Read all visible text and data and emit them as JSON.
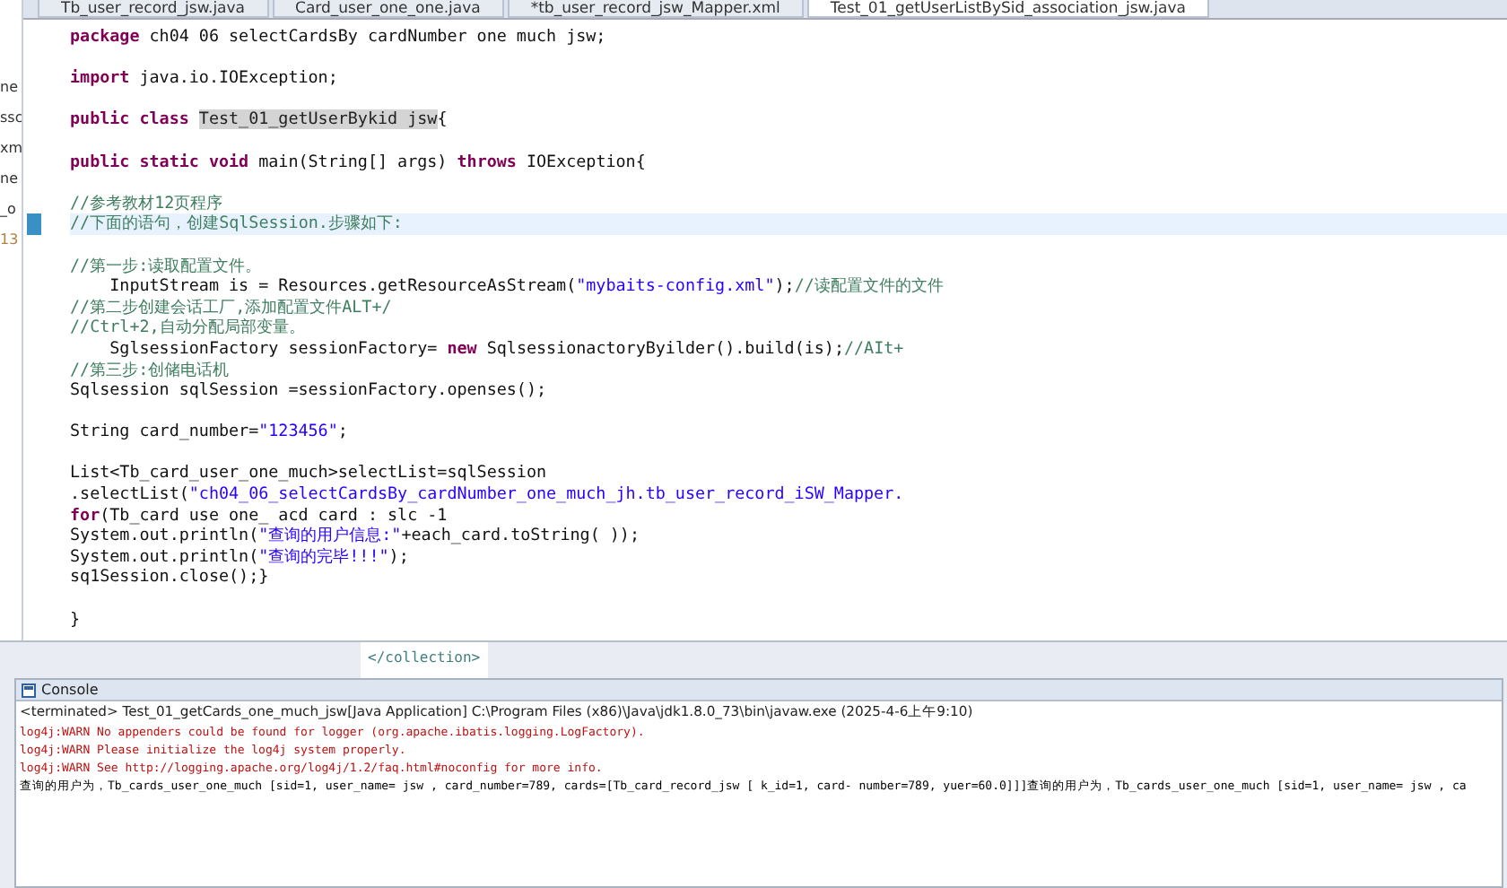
{
  "side_strip": [
    "ne",
    "ssc",
    "xm",
    "ne",
    "_o",
    "13"
  ],
  "editor_tabs": [
    {
      "label": "Tb_user_record_jsw.java",
      "selected": false
    },
    {
      "label": "Card_user_one_one.java",
      "selected": false
    },
    {
      "label": "*tb_user_record_jsw_Mapper.xml",
      "selected": false
    },
    {
      "label": "Test_01_getUserListBySid_association_jsw.java",
      "selected": true
    }
  ],
  "code_lines": [
    {
      "kind": "code",
      "current": false,
      "segments": [
        {
          "kind": "keyword",
          "text": "package"
        },
        {
          "kind": "plain",
          "text": " ch04 06 selectCardsBy cardNumber one much jsw;"
        }
      ]
    },
    {
      "kind": "blank",
      "current": false
    },
    {
      "kind": "code",
      "current": false,
      "segments": [
        {
          "kind": "keyword",
          "text": "import"
        },
        {
          "kind": "plain",
          "text": " java.io.IOException;"
        }
      ]
    },
    {
      "kind": "blank",
      "current": false
    },
    {
      "kind": "code",
      "current": false,
      "segments": [
        {
          "kind": "keyword",
          "text": "public class "
        },
        {
          "kind": "highlight",
          "text": "Test_01_getUserBykid jsw"
        },
        {
          "kind": "plain",
          "text": "{"
        }
      ]
    },
    {
      "kind": "blank",
      "current": false
    },
    {
      "kind": "code",
      "current": false,
      "segments": [
        {
          "kind": "keyword",
          "text": "public static void"
        },
        {
          "kind": "plain",
          "text": " main(String[] args) "
        },
        {
          "kind": "keyword",
          "text": "throws"
        },
        {
          "kind": "plain",
          "text": " IOException{"
        }
      ]
    },
    {
      "kind": "blank",
      "current": false
    },
    {
      "kind": "code",
      "current": false,
      "segments": [
        {
          "kind": "comment",
          "text": "//参考教材12页程序"
        }
      ]
    },
    {
      "kind": "code",
      "current": true,
      "segments": [
        {
          "kind": "comment",
          "text": "//下面的语句，创建SqlSession.步骤如下:"
        }
      ]
    },
    {
      "kind": "blank",
      "current": false
    },
    {
      "kind": "code",
      "current": false,
      "segments": [
        {
          "kind": "comment",
          "text": "//第一步:读取配置文件。"
        }
      ]
    },
    {
      "kind": "code",
      "current": false,
      "segments": [
        {
          "kind": "plain",
          "text": "    InputStream is = Resources.getResourceAsStream("
        },
        {
          "kind": "string",
          "text": "\"mybaits-config.xml\""
        },
        {
          "kind": "plain",
          "text": ");"
        },
        {
          "kind": "comment",
          "text": "//读配置文件的文件"
        }
      ]
    },
    {
      "kind": "code",
      "current": false,
      "segments": [
        {
          "kind": "comment",
          "text": "//第二步创建会话工厂,添加配置文件ALT+/"
        }
      ]
    },
    {
      "kind": "code",
      "current": false,
      "segments": [
        {
          "kind": "comment",
          "text": "//Ctrl+2,自动分配局部变量。"
        }
      ]
    },
    {
      "kind": "code",
      "current": false,
      "segments": [
        {
          "kind": "plain",
          "text": "    SglsessionFactory sessionFactory= "
        },
        {
          "kind": "keyword",
          "text": "new"
        },
        {
          "kind": "plain",
          "text": " SqlsessionactoryByilder().build(is);"
        },
        {
          "kind": "comment",
          "text": "//AIt+"
        }
      ]
    },
    {
      "kind": "code",
      "current": false,
      "segments": [
        {
          "kind": "comment",
          "text": "//第三步:创储电话机"
        }
      ]
    },
    {
      "kind": "code",
      "current": false,
      "segments": [
        {
          "kind": "plain",
          "text": "Sqlsession sqlSession =sessionFactory.openses();"
        }
      ]
    },
    {
      "kind": "blank",
      "current": false
    },
    {
      "kind": "code",
      "current": false,
      "segments": [
        {
          "kind": "plain",
          "text": "String card_number="
        },
        {
          "kind": "string",
          "text": "\"123456\""
        },
        {
          "kind": "plain",
          "text": ";"
        }
      ]
    },
    {
      "kind": "blank",
      "current": false
    },
    {
      "kind": "code",
      "current": false,
      "segments": [
        {
          "kind": "plain",
          "text": "List<Tb_card_user_one_much>selectList=sqlSession"
        }
      ]
    },
    {
      "kind": "code",
      "current": false,
      "segments": [
        {
          "kind": "plain",
          "text": ".selectList("
        },
        {
          "kind": "string",
          "text": "\"ch04_06_selectCardsBy_cardNumber_one_much_jh.tb_user_record_iSW_Mapper."
        }
      ]
    },
    {
      "kind": "code",
      "current": false,
      "segments": [
        {
          "kind": "keyword",
          "text": "for"
        },
        {
          "kind": "plain",
          "text": "(Tb_card use one_ acd card : slc -1"
        }
      ]
    },
    {
      "kind": "code",
      "current": false,
      "segments": [
        {
          "kind": "plain",
          "text": "System.out.println("
        },
        {
          "kind": "string",
          "text": "\"查询的用户信息:\""
        },
        {
          "kind": "plain",
          "text": "+each_card.toString( ));"
        }
      ]
    },
    {
      "kind": "code",
      "current": false,
      "segments": [
        {
          "kind": "plain",
          "text": "System.out.println("
        },
        {
          "kind": "string",
          "text": "\"查询的完毕!!!\""
        },
        {
          "kind": "plain",
          "text": ");"
        }
      ]
    },
    {
      "kind": "code",
      "current": false,
      "segments": [
        {
          "kind": "plain",
          "text": "sq1Session.close();}"
        }
      ]
    },
    {
      "kind": "blank",
      "current": false
    },
    {
      "kind": "code",
      "current": false,
      "segments": [
        {
          "kind": "plain",
          "text": "}"
        }
      ]
    }
  ],
  "xml_preview": "</collection>",
  "console": {
    "title": "Console",
    "header": "<terminated> Test_01_getCards_one_much_jsw[Java Application] C:\\Program Files (x86)\\Java\\jdk1.8.0_73\\bin\\javaw.exe (2025-4-6上午9:10)",
    "lines": [
      {
        "kind": "error",
        "text": "log4j:WARN No appenders could be found for logger (org.apache.ibatis.logging.LogFactory)."
      },
      {
        "kind": "error",
        "text": "log4j:WARN Please initialize the log4j system properly."
      },
      {
        "kind": "error",
        "text": "log4j:WARN See http://logging.apache.org/log4j/1.2/faq.html#noconfig for more info."
      },
      {
        "kind": "output",
        "text": "查询的用户为，Tb_cards_user_one_much [sid=1, user_name= jsw , card_number=789, cards=[Tb_card_record_jsw [ k_id=1,  card- number=789, yuer=60.0]]]查询的用户为，Tb_cards_user_one_much [sid=1, user_name= jsw , ca"
      }
    ]
  }
}
